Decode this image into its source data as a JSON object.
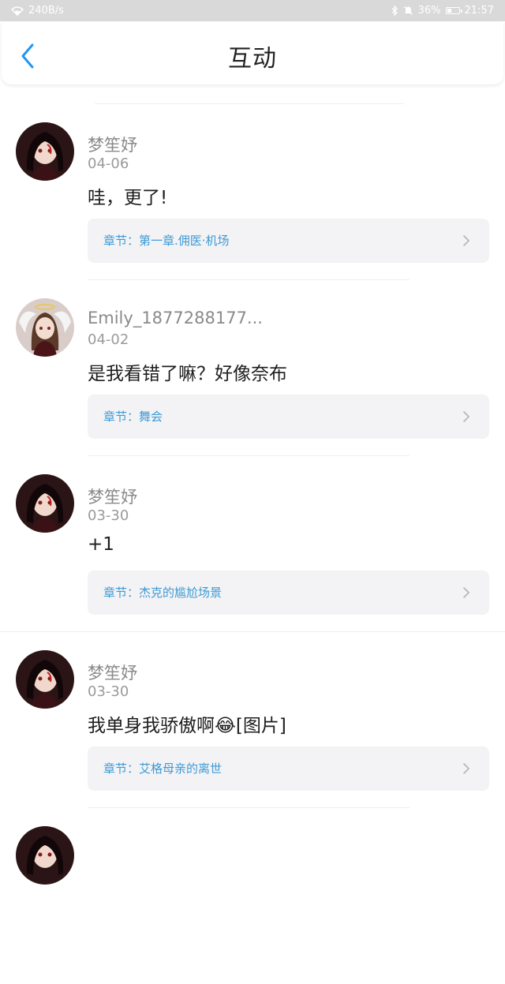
{
  "status_bar": {
    "network_speed": "240B/s",
    "battery": "36%",
    "battery_level": 0.36,
    "time": "21:57",
    "icons": [
      "wifi-icon",
      "bluetooth-icon",
      "mute-icon",
      "battery-icon"
    ]
  },
  "header": {
    "title": "互动",
    "back_icon": "chevron-left-icon"
  },
  "colors": {
    "accent": "#3d9ad6",
    "back_icon": "#2196f3"
  },
  "comments": [
    {
      "username": "梦笙妤",
      "date": "04-06",
      "content": "哇，更了!",
      "chapter": "章节：第一章.佣医·机场"
    },
    {
      "username": "Emily_1877288177...",
      "date": "04-02",
      "content": "是我看错了嘛？好像奈布",
      "chapter": "章节：舞会"
    },
    {
      "username": "梦笙妤",
      "date": "03-30",
      "content": "+1",
      "chapter": "章节：杰克的尴尬场景"
    },
    {
      "username": "梦笙妤",
      "date": "03-30",
      "content": "我单身我骄傲啊😂[图片]",
      "chapter": "章节：艾格母亲的离世"
    }
  ]
}
